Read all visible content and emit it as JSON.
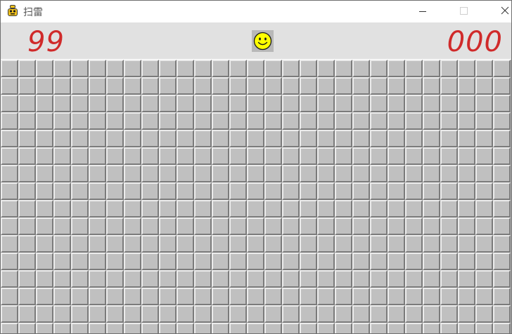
{
  "window": {
    "title": "扫雷",
    "app_icon": "pygame-snake-icon",
    "controls": [
      "minimize-icon",
      "maximize-icon",
      "close-icon"
    ]
  },
  "status_bar": {
    "mines_remaining": "99",
    "face": "smiley-face-icon",
    "timer": "000"
  },
  "board": {
    "visible_columns": 29,
    "visible_rows": 16,
    "cell_state": "covered"
  },
  "colors": {
    "counter": "#d02a2a",
    "face": "#ffff00",
    "cell": "#c0c0c0"
  }
}
